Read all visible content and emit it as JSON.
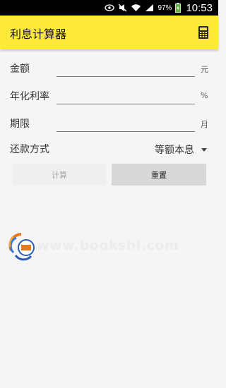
{
  "status_bar": {
    "battery_percent": "97%",
    "time": "10:53",
    "icons": [
      "eye-icon",
      "mute-icon",
      "wifi-icon",
      "signal-icon",
      "battery-charging-icon"
    ]
  },
  "app_bar": {
    "title": "利息计算器",
    "action_icon": "calculator-icon"
  },
  "form": {
    "amount": {
      "label": "金额",
      "value": "",
      "unit": "元"
    },
    "rate": {
      "label": "年化利率",
      "value": "",
      "unit": "%"
    },
    "term": {
      "label": "期限",
      "value": "",
      "unit": "月"
    },
    "repayment": {
      "label": "还款方式",
      "selected": "等额本息"
    }
  },
  "buttons": {
    "calculate": "计算",
    "reset": "重置"
  },
  "watermark": {
    "url": "www.bookshi.com"
  },
  "colors": {
    "app_bar": "#ffea3b",
    "background": "#f5f5f5",
    "status_bar": "#000000"
  }
}
